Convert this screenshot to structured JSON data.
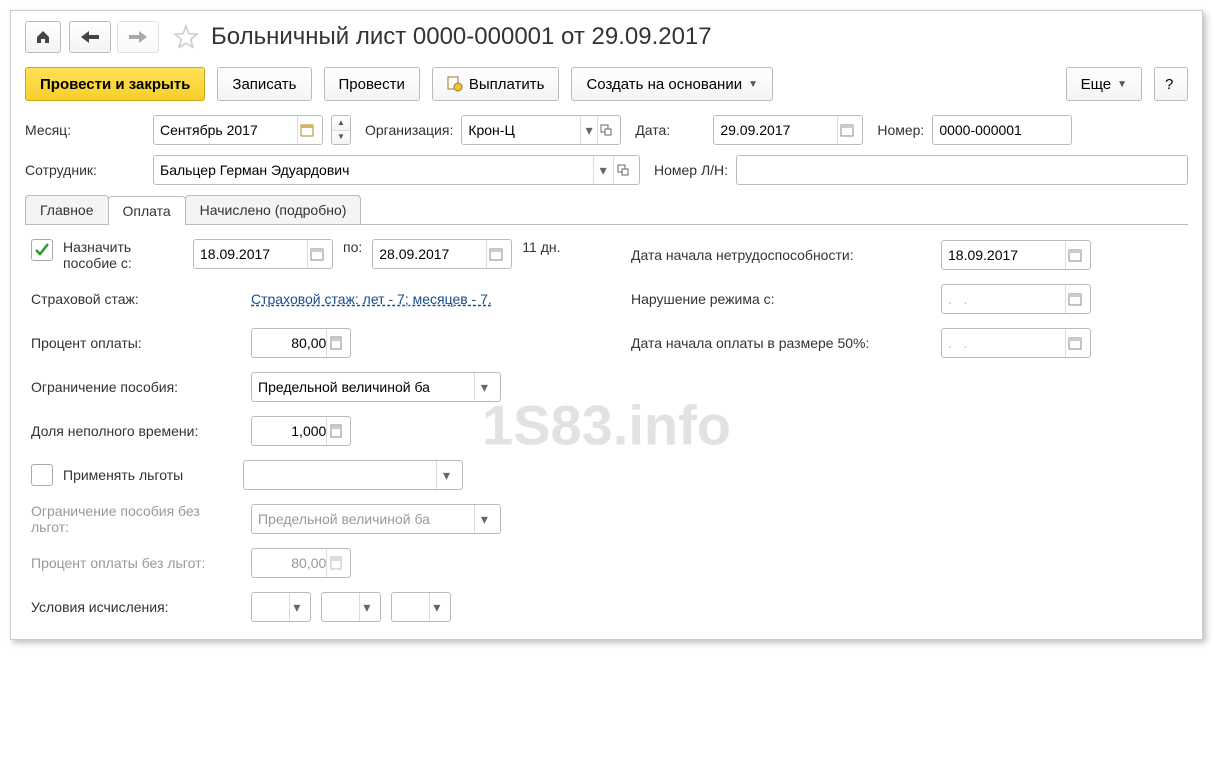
{
  "title": "Больничный лист 0000-000001 от 29.09.2017",
  "toolbar": {
    "primary": "Провести и закрыть",
    "save": "Записать",
    "post": "Провести",
    "pay": "Выплатить",
    "createOn": "Создать на основании",
    "more": "Еще",
    "help": "?"
  },
  "fields": {
    "month_label": "Месяц:",
    "month_value": "Сентябрь 2017",
    "org_label": "Организация:",
    "org_value": "Крон-Ц",
    "date_label": "Дата:",
    "date_value": "29.09.2017",
    "number_label": "Номер:",
    "number_value": "0000-000001",
    "employee_label": "Сотрудник:",
    "employee_value": "Бальцер Герман Эдуардович",
    "ln_label": "Номер Л/Н:",
    "ln_value": ""
  },
  "tabs": [
    "Главное",
    "Оплата",
    "Начислено (подробно)"
  ],
  "payment": {
    "assign_label": "Назначить пособие с:",
    "from": "18.09.2017",
    "to_label": "по:",
    "to": "28.09.2017",
    "days": "11 дн.",
    "seniority_label": "Страховой стаж:",
    "seniority_link": "Страховой стаж: лет - 7;  месяцев - 7.",
    "percent_label": "Процент оплаты:",
    "percent_value": "80,00",
    "limit_label": "Ограничение пособия:",
    "limit_value": "Предельной величиной ба",
    "parttime_label": "Доля неполного времени:",
    "parttime_value": "1,000",
    "use_discount_label": "Применять льготы",
    "limit_wo_label": "Ограничение пособия без льгот:",
    "limit_wo_value": "Предельной величиной ба",
    "percent_wo_label": "Процент оплаты без льгот:",
    "percent_wo_value": "80,00",
    "conditions_label": "Условия исчисления:"
  },
  "right": {
    "disability_label": "Дата начала нетрудоспособности:",
    "disability_value": "18.09.2017",
    "violation_label": "Нарушение режима с:",
    "violation_value": ".   .",
    "pay50_label": "Дата начала оплаты в размере 50%:",
    "pay50_value": ".   ."
  },
  "watermark": "1S83.info"
}
